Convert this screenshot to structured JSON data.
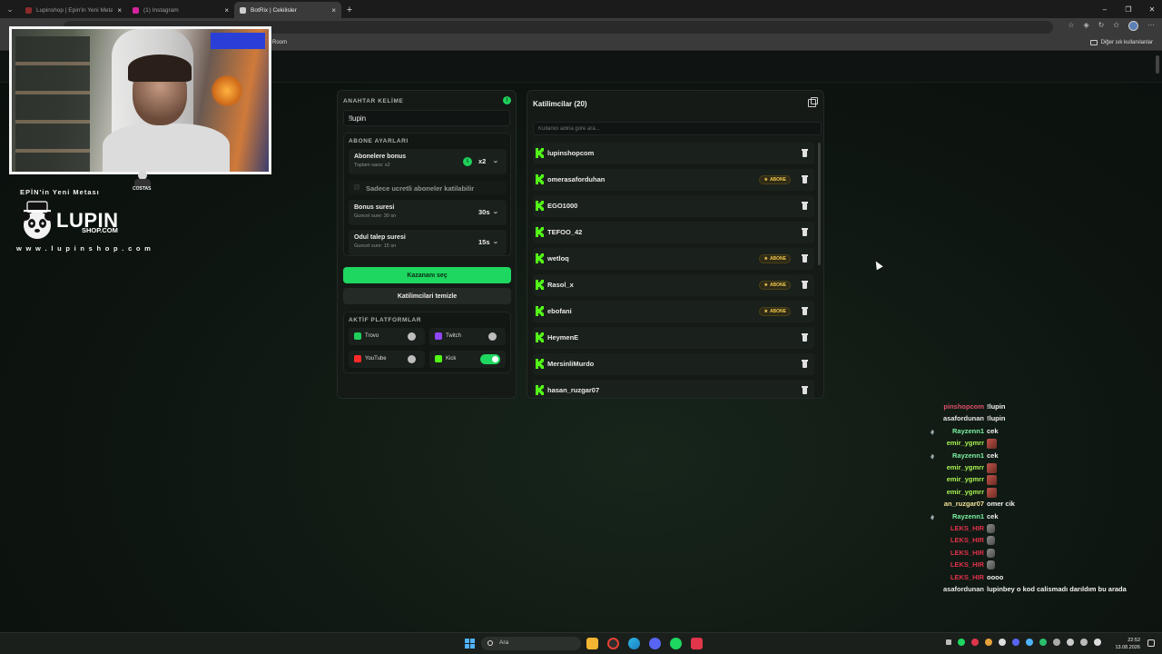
{
  "browser": {
    "tabs": [
      {
        "label": "Lupinshop | Epin'in Yeni Metası | ...",
        "favicon_color": "#8a2a2a",
        "active": false
      },
      {
        "label": "(1) Instagram",
        "favicon_color": "#d6249f",
        "active": false
      },
      {
        "label": "BotRix | Cekilisler",
        "favicon_color": "#cccccc",
        "active": true
      }
    ],
    "tab_close": "×",
    "new_tab": "+",
    "window_controls": {
      "minimize": "–",
      "maximize": "❐",
      "close": "✕"
    },
    "bookmarks": {
      "room": "Room",
      "other": "Diğer sık kullanılanlar"
    }
  },
  "overlay": {
    "cam_badge": "COSTAS",
    "brand_sub": "EPİN'in Yeni Metası",
    "brand_name": "LUPIN",
    "brand_name2": "SHOP.COM",
    "brand_url": "w w w . l u p i n s h o p . c o m"
  },
  "settings": {
    "keyword_title": "ANAHTAR KELİME",
    "keyword_value": "!lupin",
    "status_icon": "!",
    "subscriber_title": "ABONE AYARLARI",
    "bonus": {
      "title": "Abonelere bonus",
      "sub": "Toplam sans: x2",
      "value": "x2",
      "info": "i"
    },
    "only_paid": "Sadece ucretli aboneler katilabilir",
    "bonus_time": {
      "title": "Bonus suresi",
      "sub": "Guncel sure: 30 sn",
      "value": "30s"
    },
    "claim_time": {
      "title": "Odul talep suresi",
      "sub": "Guncel sure: 15 sn",
      "value": "15s"
    },
    "pick_winner": "Kazananı seç",
    "clear_participants": "Katilimcilari temizle",
    "platforms_title": "AKTİF PLATFORMLAR",
    "platforms": [
      {
        "name": "Trovo",
        "color": "#1fcf5a",
        "enabled": false
      },
      {
        "name": "Twitch",
        "color": "#9146ff",
        "enabled": false
      },
      {
        "name": "YouTube",
        "color": "#ff2a2a",
        "enabled": false
      },
      {
        "name": "Kick",
        "color": "#53fc18",
        "enabled": true
      }
    ]
  },
  "participants": {
    "title": "Katilimcilar (20)",
    "search_placeholder": "Kullanici adina gore ara...",
    "badge_label": "ABONE",
    "badge_icon": "★",
    "rows": [
      {
        "name": "lupinshopcom",
        "subscriber": false
      },
      {
        "name": "omerasaforduhan",
        "subscriber": true
      },
      {
        "name": "EGO1000",
        "subscriber": false
      },
      {
        "name": "TEFOO_42",
        "subscriber": false
      },
      {
        "name": "wetloq",
        "subscriber": true
      },
      {
        "name": "Rasol_x",
        "subscriber": true
      },
      {
        "name": "ebofani",
        "subscriber": true
      },
      {
        "name": "HeymenE",
        "subscriber": false
      },
      {
        "name": "MersinliMurdo",
        "subscriber": false
      },
      {
        "name": "hasan_ruzgar07",
        "subscriber": false
      }
    ]
  },
  "chat": [
    {
      "user": "pinshopcom",
      "color": "#e0506a",
      "msg": "!lupin",
      "badge": false,
      "emote": ""
    },
    {
      "user": "asafordunan",
      "color": "#e6e6e6",
      "msg": "!lupin",
      "badge": false,
      "emote": ""
    },
    {
      "user": "Rayzenn1",
      "color": "#7cf2a1",
      "msg": "cek",
      "badge": true,
      "emote": ""
    },
    {
      "user": "emir_ygmrr",
      "color": "#a8f050",
      "msg": "",
      "badge": false,
      "emote": "red"
    },
    {
      "user": "Rayzenn1",
      "color": "#7cf2a1",
      "msg": "cek",
      "badge": true,
      "emote": ""
    },
    {
      "user": "emir_ygmrr",
      "color": "#a8f050",
      "msg": "",
      "badge": false,
      "emote": "red"
    },
    {
      "user": "emir_ygmrr",
      "color": "#a8f050",
      "msg": "",
      "badge": false,
      "emote": "red"
    },
    {
      "user": "emir_ygmrr",
      "color": "#a8f050",
      "msg": "",
      "badge": false,
      "emote": "red"
    },
    {
      "user": "an_ruzgar07",
      "color": "#f2e29a",
      "msg": "omer cik",
      "badge": false,
      "emote": ""
    },
    {
      "user": "Rayzenn1",
      "color": "#7cf2a1",
      "msg": "cek",
      "badge": true,
      "emote": ""
    },
    {
      "user": "LEKS_HIR",
      "color": "#e0304a",
      "msg": "",
      "badge": false,
      "emote": "grey"
    },
    {
      "user": "LEKS_HIR",
      "color": "#e0304a",
      "msg": "",
      "badge": false,
      "emote": "grey"
    },
    {
      "user": "LEKS_HIR",
      "color": "#e0304a",
      "msg": "",
      "badge": false,
      "emote": "grey"
    },
    {
      "user": "LEKS_HIR",
      "color": "#e0304a",
      "msg": "",
      "badge": false,
      "emote": "grey"
    },
    {
      "user": "LEKS_HIR",
      "color": "#e0304a",
      "msg": "oooo",
      "badge": false,
      "emote": ""
    },
    {
      "user": "asafordunan",
      "color": "#e6e6e6",
      "msg": "lupinbey o kod calismadı darıldım bu arada",
      "badge": false,
      "emote": ""
    }
  ],
  "taskbar": {
    "search_label": "Ara",
    "time": "22:52",
    "date": "13.08.2026"
  }
}
